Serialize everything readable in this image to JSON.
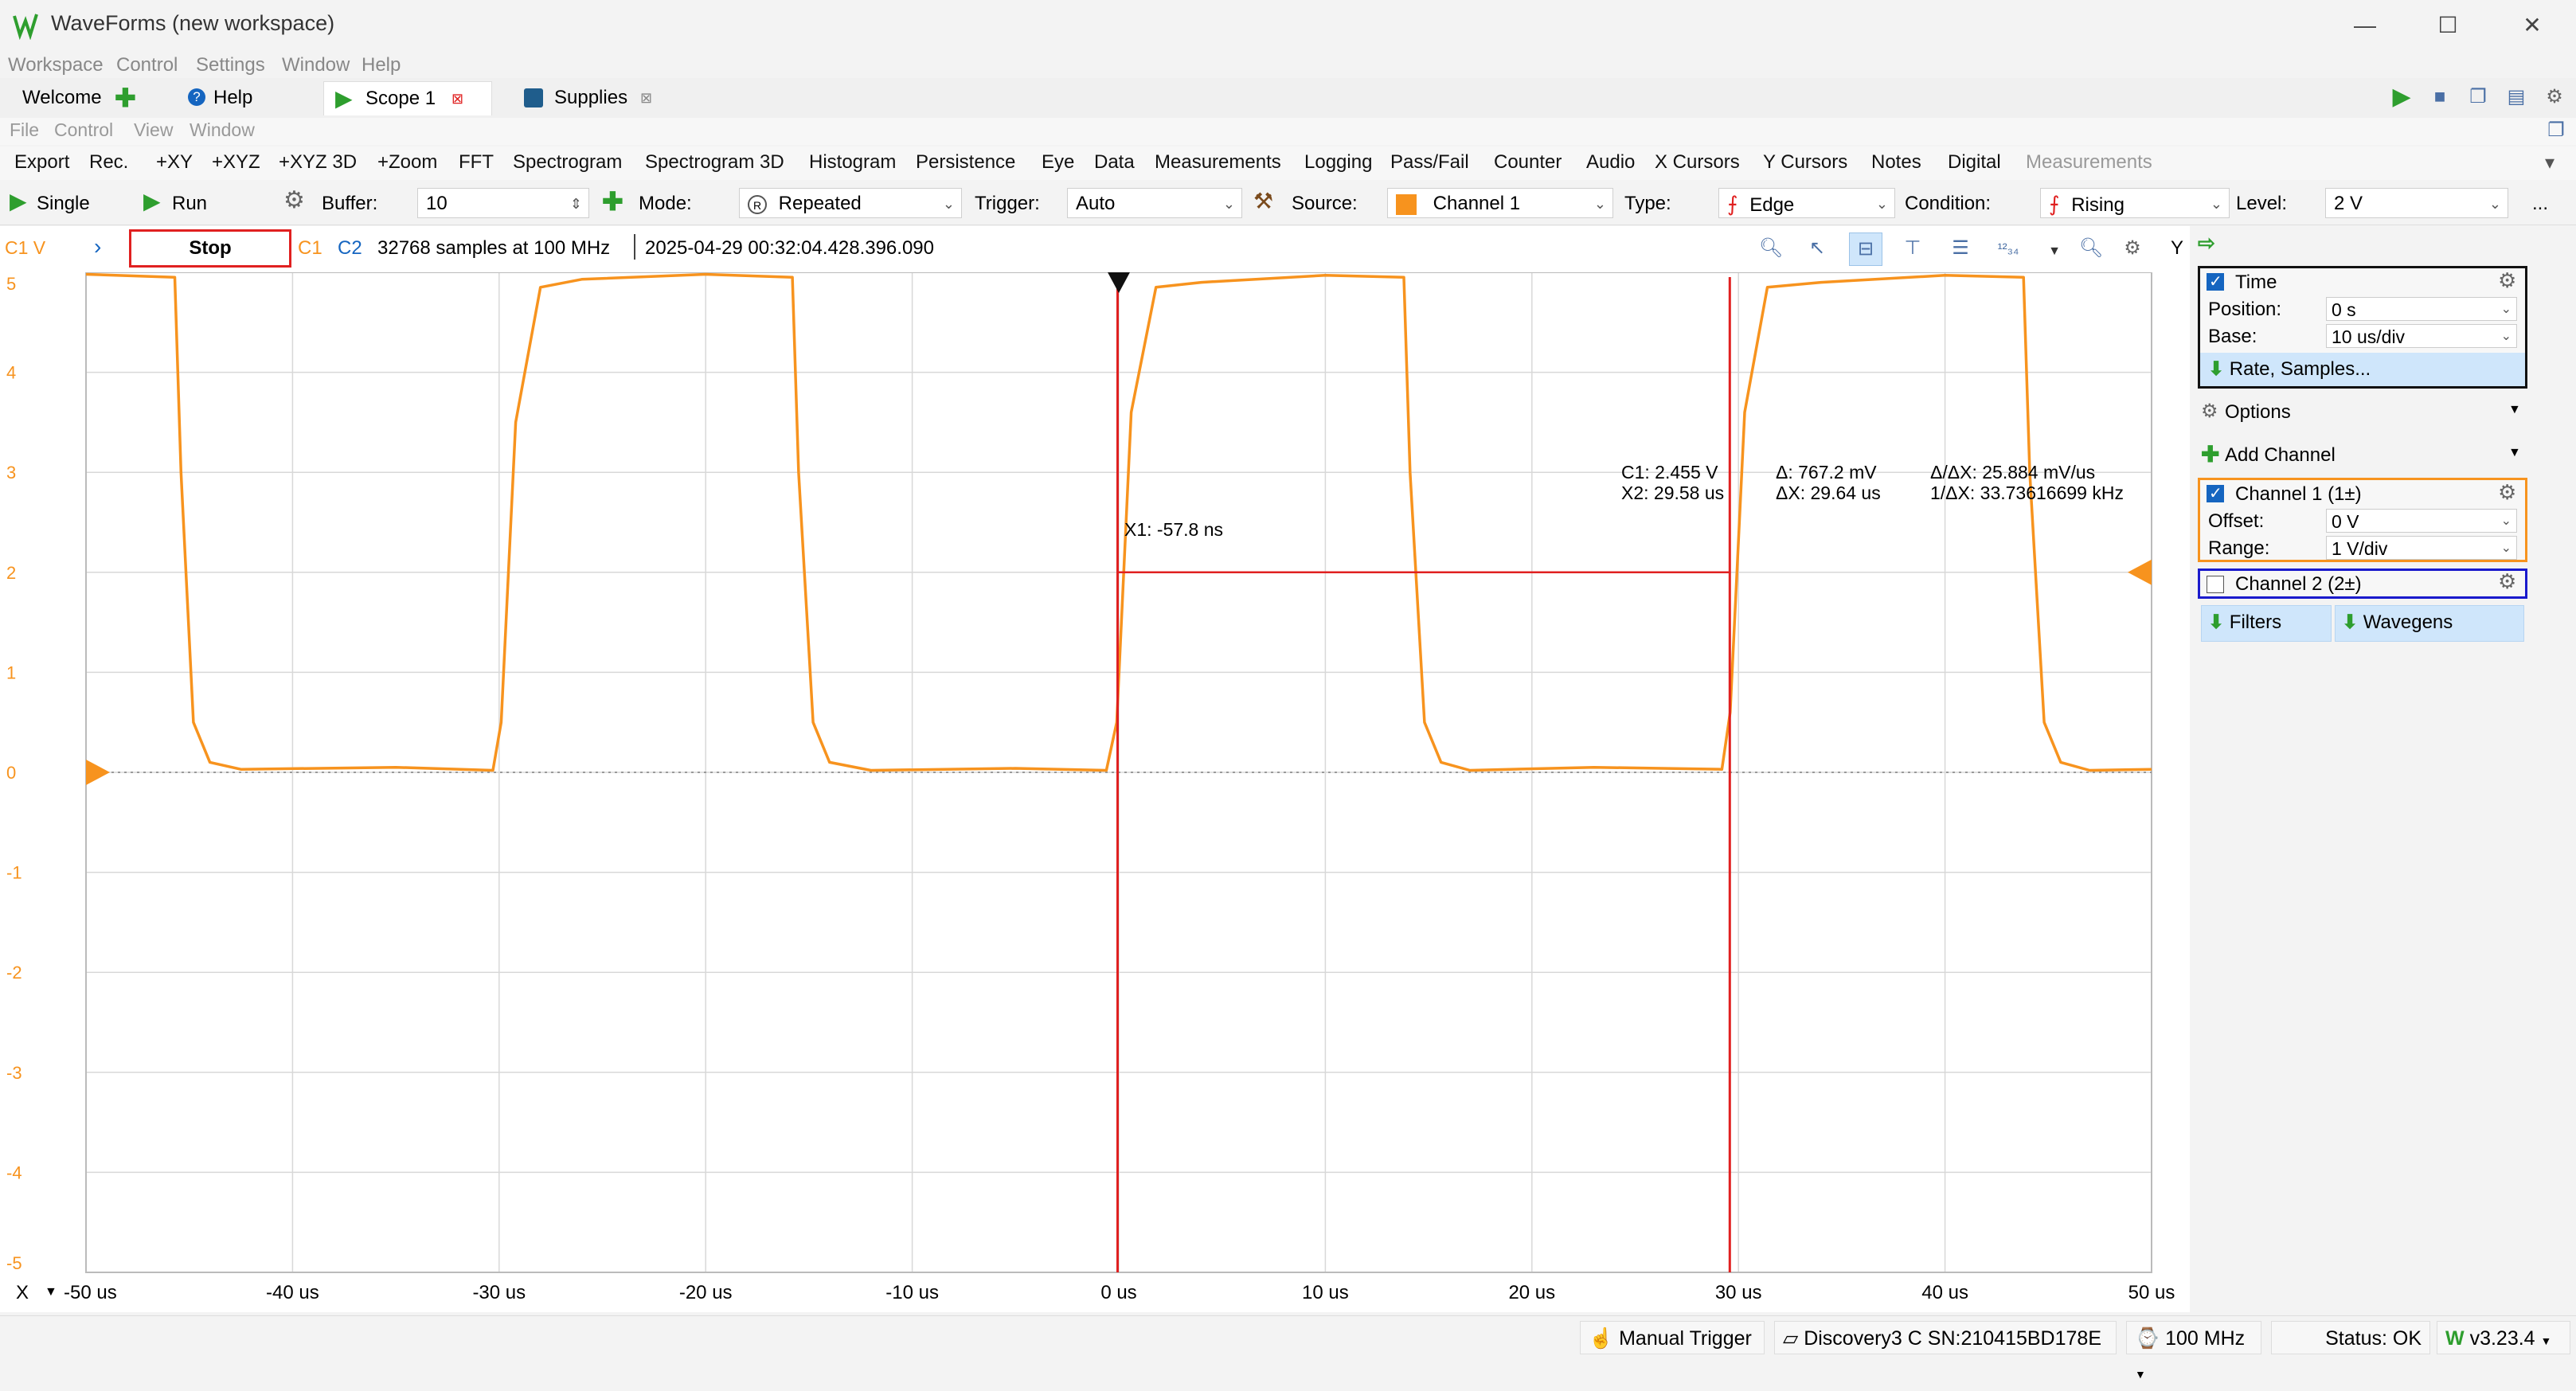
{
  "window": {
    "title": "WaveForms (new workspace)"
  },
  "menubar": [
    "Workspace",
    "Control",
    "Settings",
    "Window",
    "Help"
  ],
  "tabs": [
    {
      "label": "Welcome",
      "icon": "plus-icon"
    },
    {
      "label": "Help",
      "icon": "help-icon"
    },
    {
      "label": "Scope 1",
      "icon": "play-icon",
      "active": true
    },
    {
      "label": "Supplies",
      "icon": "supplies-icon"
    }
  ],
  "submenu": [
    "File",
    "Control",
    "View",
    "Window"
  ],
  "toolbar1": [
    "Export",
    "Rec.",
    "+XY",
    "+XYZ",
    "+XYZ 3D",
    "+Zoom",
    "FFT",
    "Spectrogram",
    "Spectrogram 3D",
    "Histogram",
    "Persistence",
    "Eye",
    "Data",
    "Measurements",
    "Logging",
    "Pass/Fail",
    "Counter",
    "Audio",
    "X Cursors",
    "Y Cursors",
    "Notes",
    "Digital",
    "Measurements"
  ],
  "toolbar2": {
    "single": "Single",
    "run": "Run",
    "buffer_label": "Buffer:",
    "buffer_value": "10",
    "mode_label": "Mode:",
    "mode_value": "Repeated",
    "trigger_label": "Trigger:",
    "trigger_value": "Auto",
    "source_label": "Source:",
    "source_value": "Channel 1",
    "type_label": "Type:",
    "type_value": "Edge",
    "condition_label": "Condition:",
    "condition_value": "Rising",
    "level_label": "Level:",
    "level_value": "2 V",
    "more": "..."
  },
  "statusline": {
    "axis_label": "C1 V",
    "stop": "Stop",
    "c1": "C1",
    "c2": "C2",
    "info": "32768 samples at 100 MHz",
    "timestamp": "2025-04-29 00:32:04.428.396.090",
    "y_label": "Y"
  },
  "cursors": {
    "x1": "X1: -57.8 ns",
    "c1": "C1: 2.455 V",
    "x2": "X2: 29.58 us",
    "dv": "Δ: 767.2 mV",
    "dx": "ΔX: 29.64 us",
    "slope": "Δ/ΔX: 25.884 mV/us",
    "freq": "1/ΔX: 33.73616699 kHz"
  },
  "x_axis_label": "X",
  "colors": {
    "trace": "#f7931e",
    "cursor": "#e02020",
    "accent": "#1565c0"
  },
  "chart_data": {
    "type": "line",
    "title": "",
    "xlabel": "",
    "ylabel": "C1 V",
    "xlim": [
      -50,
      50
    ],
    "ylim": [
      -5,
      5
    ],
    "x_ticks": [
      "-50 us",
      "-40 us",
      "-30 us",
      "-20 us",
      "-10 us",
      "0 us",
      "10 us",
      "20 us",
      "30 us",
      "40 us",
      "50 us"
    ],
    "y_ticks": [
      "5",
      "4",
      "3",
      "2",
      "1",
      "0",
      "-1",
      "-2",
      "-3",
      "-4",
      "-5"
    ],
    "series": [
      {
        "x": [
          -50,
          -45.7,
          -45.4,
          -44.8,
          -44.0,
          -42.5,
          -35,
          -30.3,
          -29.9,
          -29.2,
          -28.0,
          -26,
          -20,
          -15.8,
          -15.5,
          -14.8,
          -14.0,
          -12,
          -5,
          -0.6,
          -0.1,
          0.6,
          1.8,
          4,
          10,
          13.8,
          14.1,
          14.8,
          15.6,
          17,
          23,
          29.2,
          29.6,
          30.3,
          31.4,
          34,
          40,
          43.8,
          44.1,
          44.8,
          45.6,
          47,
          50
        ],
        "y": [
          4.98,
          4.95,
          3.0,
          0.5,
          0.1,
          0.03,
          0.05,
          0.02,
          0.5,
          3.5,
          4.85,
          4.93,
          4.98,
          4.95,
          3.0,
          0.5,
          0.1,
          0.02,
          0.04,
          0.02,
          0.5,
          3.6,
          4.85,
          4.9,
          4.97,
          4.95,
          3.0,
          0.5,
          0.1,
          0.02,
          0.05,
          0.03,
          0.6,
          3.6,
          4.85,
          4.9,
          4.97,
          4.95,
          3.0,
          0.5,
          0.1,
          0.02,
          0.03
        ]
      }
    ],
    "cursors_x": [
      -0.0578,
      29.58
    ],
    "cursor_hline_y": 2.0
  },
  "panel": {
    "time": {
      "label": "Time",
      "position_label": "Position:",
      "position_value": "0 s",
      "base_label": "Base:",
      "base_value": "10 us/div",
      "rate": "Rate, Samples..."
    },
    "options": "Options",
    "add_channel": "Add Channel",
    "ch1": {
      "label": "Channel 1 (1±)",
      "offset_label": "Offset:",
      "offset_value": "0 V",
      "range_label": "Range:",
      "range_value": "1 V/div"
    },
    "ch2": {
      "label": "Channel 2 (2±)"
    },
    "filters": "Filters",
    "wavegens": "Wavegens"
  },
  "statusbar": {
    "trigger": "Manual Trigger",
    "device": "Discovery3 C SN:210415BD178E",
    "freq": "100 MHz",
    "status": "Status: OK",
    "version": "v3.23.4"
  }
}
